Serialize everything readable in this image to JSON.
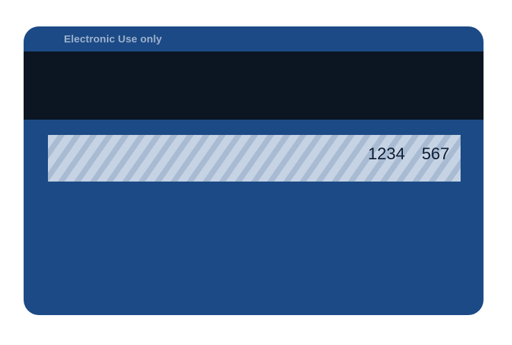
{
  "card": {
    "usage_label": "Electronic Use only",
    "signature_panel": {
      "account_digits": "1234",
      "security_code": "567"
    }
  },
  "colors": {
    "card_body": "#1c4a86",
    "magnetic_stripe": "#0b1622",
    "panel_light_stripe": "#c5d3e4",
    "panel_dark_stripe": "#a9bbd2",
    "label_text": "#9db1cc",
    "digits_text": "#0f1d33"
  }
}
